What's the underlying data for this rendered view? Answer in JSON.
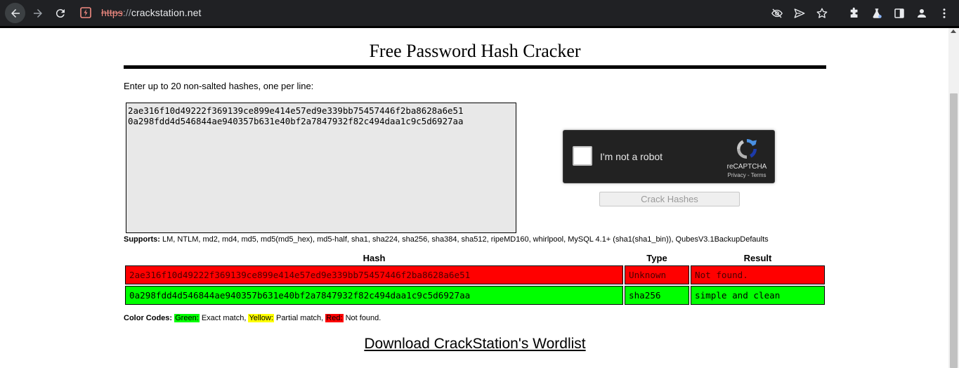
{
  "browser": {
    "url_scheme": "https",
    "url_sep": "://",
    "url_host": "crackstation.net",
    "icons": [
      "back-icon",
      "forward-icon",
      "reload-icon",
      "site-info-icon",
      "eye-off-icon",
      "send-icon",
      "star-icon",
      "extensions-icon",
      "labs-icon",
      "side-panel-icon",
      "profile-icon",
      "menu-icon"
    ]
  },
  "page": {
    "title": "Free Password Hash Cracker",
    "intro": "Enter up to 20 non-salted hashes, one per line:",
    "input_value": "2ae316f10d49222f369139ce899e414e57ed9e339bb75457446f2ba8628a6e51\n0a298fdd4d546844ae940357b631e40bf2a7847932f82c494daa1c9c5d6927aa",
    "captcha": {
      "label": "I'm not a robot",
      "brand": "reCAPTCHA",
      "privacy": "Privacy",
      "dash": " - ",
      "terms": "Terms"
    },
    "crack_button": "Crack Hashes",
    "supports_label": "Supports:",
    "supports_list": "LM, NTLM, md2, md4, md5, md5(md5_hex), md5-half, sha1, sha224, sha256, sha384, sha512, ripeMD160, whirlpool, MySQL 4.1+ (sha1(sha1_bin)), QubesV3.1BackupDefaults",
    "results": {
      "headers": {
        "hash": "Hash",
        "type": "Type",
        "result": "Result"
      },
      "rows": [
        {
          "hash": "2ae316f10d49222f369139ce899e414e57ed9e339bb75457446f2ba8628a6e51",
          "type": "Unknown",
          "result": "Not found.",
          "status": "red"
        },
        {
          "hash": "0a298fdd4d546844ae940357b631e40bf2a7847932f82c494daa1c9c5d6927aa",
          "type": "sha256",
          "result": "simple and clean",
          "status": "green"
        }
      ]
    },
    "color_codes": {
      "label": "Color Codes:",
      "green": "Green:",
      "green_desc": " Exact match, ",
      "yellow": "Yellow:",
      "yellow_desc": " Partial match, ",
      "red": "Red:",
      "red_desc": " Not found."
    },
    "download_link": "Download CrackStation's Wordlist"
  },
  "colors": {
    "match_exact": "#00ff00",
    "match_partial": "#ffff00",
    "not_found": "#ff0000",
    "chrome_bg": "#202124"
  }
}
